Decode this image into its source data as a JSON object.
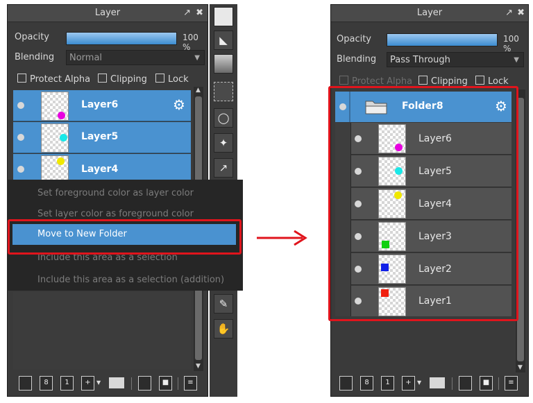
{
  "left": {
    "title": "Layer",
    "opacity_label": "Opacity",
    "opacity_value": "100 %",
    "opacity_fraction": 1.0,
    "blending_label": "Blending",
    "blending_value": "Normal",
    "checks": [
      "Protect Alpha",
      "Clipping",
      "Lock"
    ],
    "layers": [
      {
        "name": "Layer6",
        "color": "#e800e0"
      },
      {
        "name": "Layer5",
        "color": "#18e8e8"
      },
      {
        "name": "Layer4",
        "color": "#f0e800"
      }
    ],
    "menu": [
      "Set foreground color as layer color",
      "Set layer color as foreground color",
      "Move to New Folder",
      "Include this area as a selection",
      "Include this area as a selection (addition)"
    ]
  },
  "right": {
    "title": "Layer",
    "opacity_label": "Opacity",
    "opacity_value": "100 %",
    "opacity_fraction": 1.0,
    "blending_label": "Blending",
    "blending_value": "Pass Through",
    "checks": [
      "Protect Alpha",
      "Clipping",
      "Lock"
    ],
    "folder": "Folder8",
    "layers": [
      {
        "name": "Layer6",
        "color": "#e800e0"
      },
      {
        "name": "Layer5",
        "color": "#18e8e8"
      },
      {
        "name": "Layer4",
        "color": "#f0e800"
      },
      {
        "name": "Layer3",
        "color": "#10d010"
      },
      {
        "name": "Layer2",
        "color": "#1020e8"
      },
      {
        "name": "Layer1",
        "color": "#f02010"
      }
    ]
  },
  "colors": {
    "highlight": "#4a92d0",
    "annotation": "#e0141c"
  },
  "icons": [
    "popout-icon",
    "close-icon",
    "gear-icon",
    "folder-icon",
    "arrow-right-icon",
    "pen-icon",
    "fill-bucket-icon",
    "gradient-icon",
    "rect-select-icon",
    "lasso-icon",
    "magic-wand-icon",
    "transform-icon",
    "eyedropper-icon",
    "hand-icon",
    "new-layer-icon",
    "new-8bit-layer-icon",
    "new-1bit-layer-icon",
    "add-layer-menu-icon",
    "new-folder-icon",
    "duplicate-icon",
    "merge-icon",
    "trash-icon"
  ]
}
